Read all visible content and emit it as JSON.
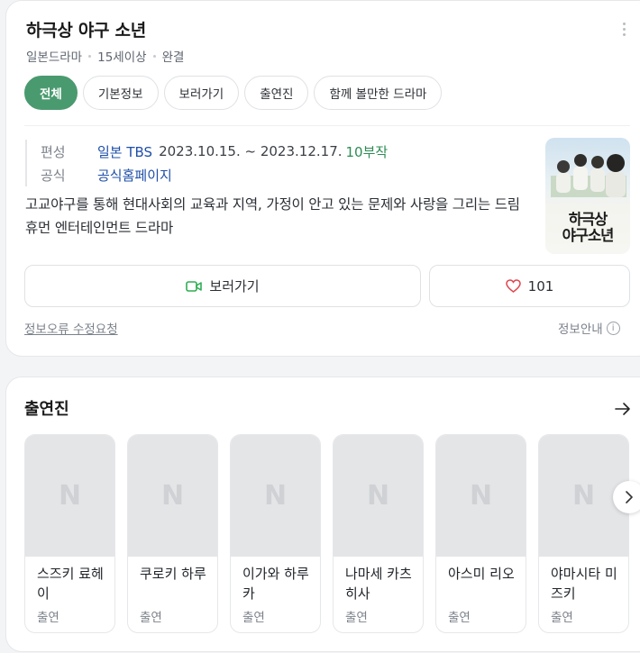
{
  "header": {
    "title": "하극상 야구 소년",
    "meta": [
      "일본드라마",
      "15세이상",
      "완결"
    ]
  },
  "tabs": [
    "전체",
    "기본정보",
    "보러가기",
    "출연진",
    "함께 볼만한 드라마"
  ],
  "info": {
    "broadcast_key": "편성",
    "broadcast_link": "일본 TBS",
    "broadcast_period": "2023.10.15. ~ 2023.12.17.",
    "episodes": "10부작",
    "official_key": "공식",
    "official_link": "공식홈페이지",
    "description": "고교야구를 통해 현대사회의 교육과 지역, 가정이 안고 있는 문제와 사랑을 그리는 드림 휴먼 엔터테인먼트 드라마"
  },
  "poster": {
    "title_line1": "하극상",
    "title_line2": "야구소년"
  },
  "actions": {
    "watch_label": "보러가기",
    "like_count": "101"
  },
  "footer": {
    "report_label": "정보오류 수정요청",
    "guide_label": "정보안내",
    "guide_icon": "i"
  },
  "cast_section": {
    "title": "출연진",
    "placeholder_letter": "N",
    "members": [
      {
        "name": "스즈키 료헤이",
        "role": "출연"
      },
      {
        "name": "쿠로키 하루",
        "role": "출연"
      },
      {
        "name": "이가와 하루카",
        "role": "출연"
      },
      {
        "name": "나마세 카츠히사",
        "role": "출연"
      },
      {
        "name": "아스미 리오",
        "role": "출연"
      },
      {
        "name": "야마시타 미즈키",
        "role": "출연"
      }
    ]
  },
  "colors": {
    "accent_green": "#4a9a6f",
    "link_blue": "#1f4fa8",
    "heart_red": "#e0454f"
  },
  "icons": {
    "watch": "video-camera-icon",
    "like": "heart-icon",
    "more": "kebab-menu-icon",
    "next": "arrow-right-icon",
    "carousel_next": "chevron-right-icon",
    "info": "info-circle-icon"
  }
}
